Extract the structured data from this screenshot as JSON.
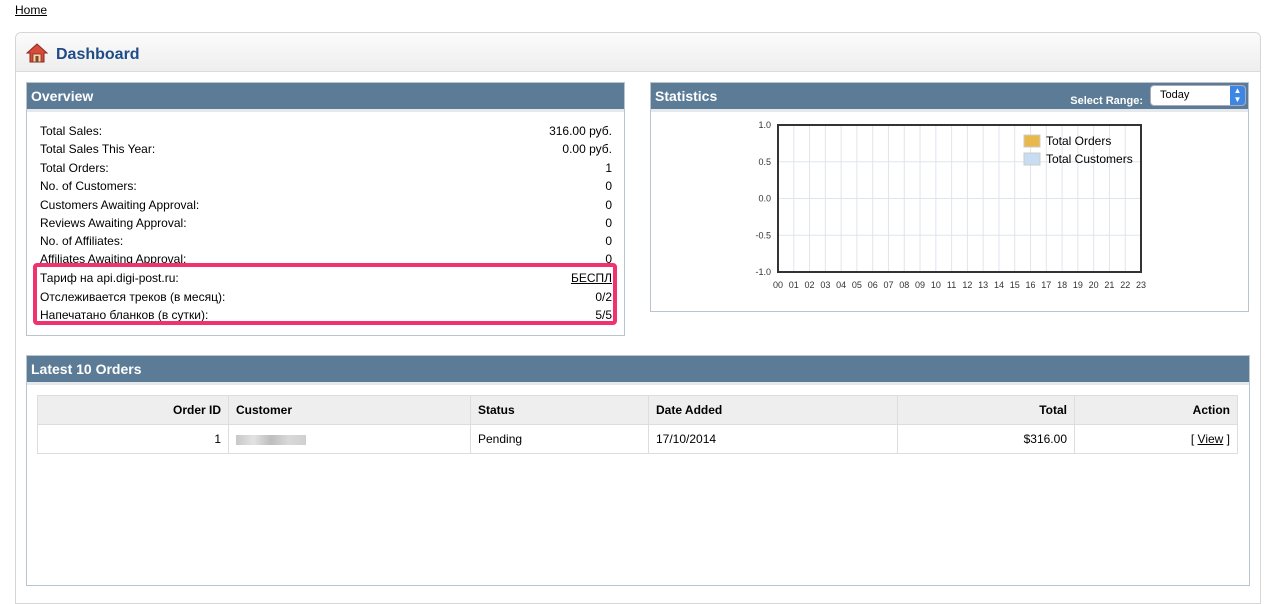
{
  "breadcrumb": {
    "home": "Home"
  },
  "dashboard": {
    "title": "Dashboard"
  },
  "overview": {
    "title": "Overview",
    "rows": [
      {
        "label": "Total Sales:",
        "value": "316.00 руб."
      },
      {
        "label": "Total Sales This Year:",
        "value": "0.00 руб."
      },
      {
        "label": "Total Orders:",
        "value": "1"
      },
      {
        "label": "No. of Customers:",
        "value": "0"
      },
      {
        "label": "Customers Awaiting Approval:",
        "value": "0"
      },
      {
        "label": "Reviews Awaiting Approval:",
        "value": "0"
      },
      {
        "label": "No. of Affiliates:",
        "value": "0"
      },
      {
        "label": "Affiliates Awaiting Approval:",
        "value": "0"
      }
    ],
    "digipost": [
      {
        "label": "Тариф на api.digi-post.ru:",
        "value": "БЕСПЛ"
      },
      {
        "label": "Отслеживается треков (в месяц):",
        "value": "0/2"
      },
      {
        "label": "Напечатано бланков (в сутки):",
        "value": "5/5"
      }
    ]
  },
  "statistics": {
    "title": "Statistics",
    "range_label": "Select Range:",
    "range_value": "Today"
  },
  "chart_data": {
    "type": "bar",
    "categories": [
      "00",
      "01",
      "02",
      "03",
      "04",
      "05",
      "06",
      "07",
      "08",
      "09",
      "10",
      "11",
      "12",
      "13",
      "14",
      "15",
      "16",
      "17",
      "18",
      "19",
      "20",
      "21",
      "22",
      "23"
    ],
    "y_ticks": [
      "1.0",
      "0.5",
      "0.0",
      "-0.5",
      "-1.0"
    ],
    "ylim": [
      -1.0,
      1.0
    ],
    "series": [
      {
        "name": "Total Orders",
        "color": "#e8b84a",
        "values": [
          0,
          0,
          0,
          0,
          0,
          0,
          0,
          0,
          0,
          0,
          0,
          0,
          0,
          0,
          0,
          0,
          0,
          0,
          0,
          0,
          0,
          0,
          0,
          0
        ]
      },
      {
        "name": "Total Customers",
        "color": "#c9ddf2",
        "values": [
          0,
          0,
          0,
          0,
          0,
          0,
          0,
          0,
          0,
          0,
          0,
          0,
          0,
          0,
          0,
          0,
          0,
          0,
          0,
          0,
          0,
          0,
          0,
          0
        ]
      }
    ],
    "grid": true,
    "legend": "top-right"
  },
  "latest": {
    "title": "Latest 10 Orders",
    "headers": {
      "order_id": "Order ID",
      "customer": "Customer",
      "status": "Status",
      "date_added": "Date Added",
      "total": "Total",
      "action": "Action"
    },
    "orders": [
      {
        "order_id": "1",
        "status": "Pending",
        "date_added": "17/10/2014",
        "total": "$316.00",
        "action_pre": "[ ",
        "action_link": "View",
        "action_post": " ]"
      }
    ]
  },
  "colors": {
    "header_bar": "#5b7b96",
    "title": "#1f4c88",
    "highlight": "#f0336f"
  }
}
